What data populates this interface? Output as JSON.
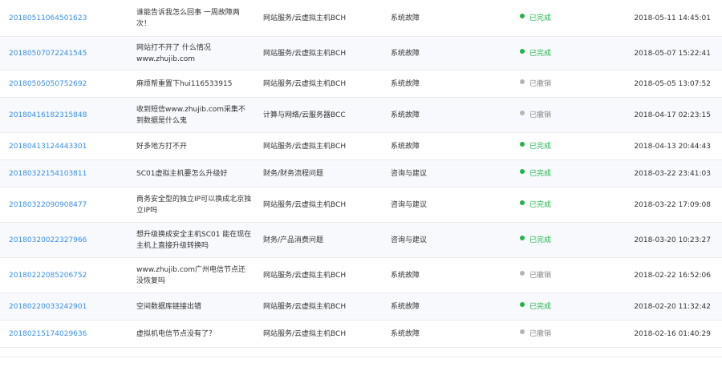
{
  "rows": [
    {
      "id": "20180511064501623",
      "title": "谁能告诉我怎么回事 一周故障两次！",
      "category": "网站服务/云虚拟主机BCH",
      "type": "系统故障",
      "status": "已完成",
      "state": "done",
      "time": "2018-05-11 14:45:01"
    },
    {
      "id": "20180507072241545",
      "title": "网站打不开了 什么情况 www.zhujib.com",
      "category": "网站服务/云虚拟主机BCH",
      "type": "系统故障",
      "status": "已完成",
      "state": "done",
      "time": "2018-05-07 15:22:41"
    },
    {
      "id": "20180505050752692",
      "title": "麻烦帮重置下hui116533915",
      "category": "网站服务/云虚拟主机BCH",
      "type": "系统故障",
      "status": "已撤销",
      "state": "cancel",
      "time": "2018-05-05 13:07:52"
    },
    {
      "id": "20180416182315848",
      "title": "收到短信www.zhujib.com采集不到数据是什么鬼",
      "category": "计算与网络/云服务器BCC",
      "type": "系统故障",
      "status": "已撤销",
      "state": "cancel",
      "time": "2018-04-17 02:23:15"
    },
    {
      "id": "20180413124443301",
      "title": "好多地方打不开",
      "category": "网站服务/云虚拟主机BCH",
      "type": "系统故障",
      "status": "已完成",
      "state": "done",
      "time": "2018-04-13 20:44:43"
    },
    {
      "id": "20180322154103811",
      "title": "SC01虚拟主机要怎么升级好",
      "category": "财务/财务流程问题",
      "type": "咨询与建议",
      "status": "已完成",
      "state": "done",
      "time": "2018-03-22 23:41:03"
    },
    {
      "id": "20180322090908477",
      "title": "商务安全型的独立IP可以换成北京独立IP吗",
      "category": "网站服务/云虚拟主机BCH",
      "type": "咨询与建议",
      "status": "已完成",
      "state": "done",
      "time": "2018-03-22 17:09:08"
    },
    {
      "id": "20180320022327966",
      "title": "想升级换成安全主机SC01 能在现在主机上直接升级转换吗",
      "category": "财务/产品消费问题",
      "type": "咨询与建议",
      "status": "已完成",
      "state": "done",
      "time": "2018-03-20 10:23:27"
    },
    {
      "id": "20180222085206752",
      "title": "www.zhujib.com广州电信节点还没恢复吗",
      "category": "网站服务/云虚拟主机BCH",
      "type": "系统故障",
      "status": "已撤销",
      "state": "cancel",
      "time": "2018-02-22 16:52:06"
    },
    {
      "id": "20180220033242901",
      "title": "空间数据库链接出错",
      "category": "网站服务/云虚拟主机BCH",
      "type": "系统故障",
      "status": "已完成",
      "state": "done",
      "time": "2018-02-20 11:32:42"
    },
    {
      "id": "20180215174029636",
      "title": "虚拟机电信节点没有了？",
      "category": "网站服务/云虚拟主机BCH",
      "type": "系统故障",
      "status": "已撤销",
      "state": "cancel",
      "time": "2018-02-16 01:40:29"
    }
  ]
}
